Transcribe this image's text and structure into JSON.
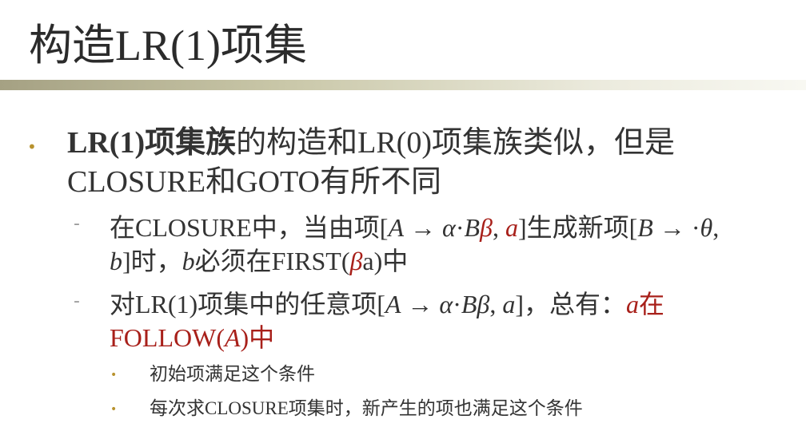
{
  "title": "构造LR(1)项集",
  "bullet1": {
    "bold_text": "LR(1)项集族",
    "line1_rest": "的构造和LR(0)项集族类似，但是",
    "line2": "CLOSURE和GOTO有所不同"
  },
  "sub1": {
    "t1": "在CLOSURE中，当由项[",
    "A": "A",
    "arrow": " → ",
    "alpha": "α",
    "dot": "·",
    "B": "B",
    "beta": "β",
    "comma": ", ",
    "a": "a",
    "t2": "]生成新项[",
    "B2": "B",
    "arrow2": " → ",
    "dot2": "·",
    "theta": "θ",
    "comma2": ",",
    "b": "b",
    "t3": "]时，",
    "b2": "b",
    "t4": "必须在FIRST(",
    "beta2": "β",
    "a2": "a",
    "t5": ")中"
  },
  "sub2": {
    "t1": "对LR(1)项集中的任意项[",
    "A": "A",
    "arrow": " → ",
    "alpha": "α",
    "dot": "·",
    "B": "B",
    "beta": "β",
    "comma": ", ",
    "a": "a",
    "t2": "]，总有：",
    "a_red": "a",
    "zai": "在",
    "follow1": "FOLLOW(",
    "A_red": "A",
    "follow2": ")中"
  },
  "sub3": {
    "items": [
      "初始项满足这个条件",
      "每次求CLOSURE项集时，新产生的项也满足这个条件"
    ]
  },
  "colors": {
    "accent_red": "#a8201a",
    "bullet_gold": "#b8922e",
    "rule_olive": "#a5a183"
  }
}
